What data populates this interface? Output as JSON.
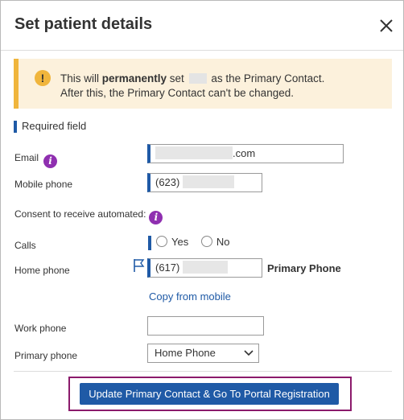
{
  "dialog": {
    "title": "Set patient details"
  },
  "alert": {
    "line1_prefix": "This will ",
    "line1_bold": "permanently",
    "line1_mid": " set ",
    "line1_suffix": " as the Primary Contact.",
    "line2": "After this, the Primary Contact can't be changed."
  },
  "required_note": "Required field",
  "fields": {
    "email": {
      "label": "Email",
      "value_suffix": ".com"
    },
    "mobile": {
      "label": "Mobile phone",
      "value_prefix": "(623)"
    },
    "consent": {
      "label": "Consent to receive automated:"
    },
    "calls": {
      "label": "Calls",
      "options": [
        "Yes",
        "No"
      ]
    },
    "home": {
      "label": "Home phone",
      "value_prefix": "(617)",
      "tag": "Primary Phone"
    },
    "copy_link": "Copy from mobile",
    "work": {
      "label": "Work phone",
      "value": ""
    },
    "primary": {
      "label": "Primary phone",
      "selected": "Home Phone"
    }
  },
  "cta": {
    "label": "Update Primary Contact & Go To Portal Registration"
  },
  "colors": {
    "accent": "#1f5aa6",
    "warning": "#f0b53c",
    "info": "#8f2fb0",
    "highlight": "#8b1a6b"
  }
}
